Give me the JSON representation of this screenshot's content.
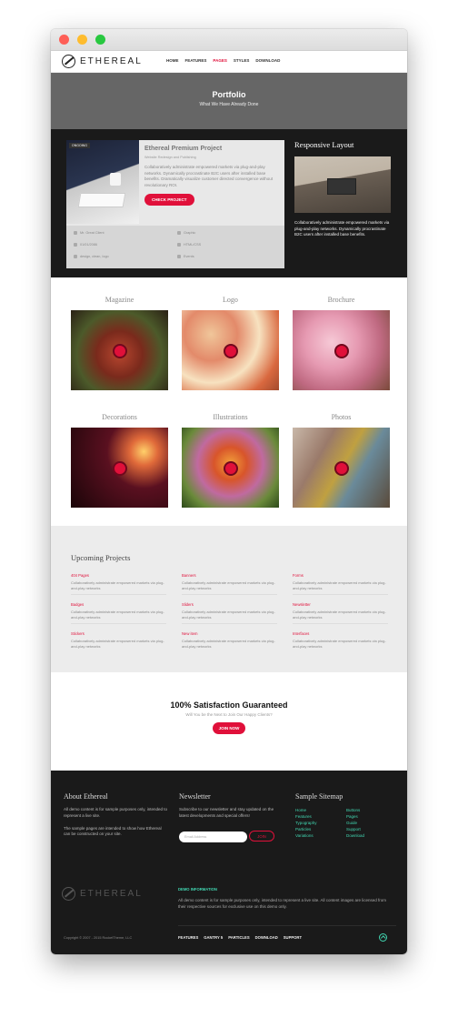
{
  "nav": {
    "logo_text": "ETHEREAL",
    "items": [
      "HOME",
      "FEATURES",
      "PAGES",
      "STYLES",
      "DOWNLOAD"
    ]
  },
  "hero": {
    "title": "Portfolio",
    "subtitle": "What We Have Already Done"
  },
  "featured": {
    "badge": "ONGOING",
    "title": "Ethereal Premium Project",
    "subtitle": "Website Redesign and Publishing",
    "description": "Collaboratively administrate empowered markets via plug-and-play networks. Dynamically procrastinate B2C users after installed base benefits. Dramatically visualize customer directed convergence without revolutionary ROI.",
    "button": "CHECK PROJECT",
    "meta": {
      "client": "Mr. Great Client",
      "date": "01/01/2086",
      "tags": "design, clean, logo",
      "type1": "Graphic",
      "type2": "HTML/CSS",
      "type3": "Events"
    }
  },
  "sidebar": {
    "title": "Responsive Layout",
    "text": "Collaboratively administrate empowered markets via plug-and-play networks. Dynamically procrastinate B2C users after installed base benefits."
  },
  "portfolio": [
    {
      "title": "Magazine"
    },
    {
      "title": "Logo"
    },
    {
      "title": "Brochure"
    },
    {
      "title": "Decorations"
    },
    {
      "title": "Illustrations"
    },
    {
      "title": "Photos"
    }
  ],
  "upcoming": {
    "title": "Upcoming Projects",
    "desc": "Collaboratively administrate empowered markets via plug-and-play networks",
    "items": [
      "404 Pages",
      "Banners",
      "Forms",
      "Badges",
      "Sliders",
      "Newsletter",
      "Stickers",
      "New item",
      "Interfaces"
    ]
  },
  "satisfaction": {
    "title": "100% Satisfaction Guaranteed",
    "subtitle": "Will You be the Next to Join Our Happy Clients?",
    "button": "JOIN NOW"
  },
  "footer": {
    "about_title": "About Ethereal",
    "about_p1": "All demo content is for sample purposes only, intended to represent a live site.",
    "about_p2": "The sample pages are intended to show how Ethereal can be constructed on your site.",
    "newsletter_title": "Newsletter",
    "newsletter_text": "Subscribe to our newsletter and stay updated on the latest developments and special offers!",
    "email_placeholder": "Email Address",
    "join": "JOIN",
    "sitemap_title": "Sample Sitemap",
    "sitemap_links": [
      "Home",
      "Buttons",
      "Features",
      "Pages",
      "Typography",
      "Guide",
      "Particles",
      "Support",
      "Variations",
      "Download"
    ],
    "logo_text": "ETHEREAL",
    "demo_heading": "DEMO INFORMATION",
    "demo_text": "All demo content is for sample purposes only, intended to represent a live site. All content images are licensed from their respective sources for exclusive use on this demo only.",
    "copyright": "Copyright © 2007 - 2015 RocketTheme, LLC",
    "links": [
      "FEATURES",
      "GANTRY 5",
      "PARTICLES",
      "DOWNLOAD",
      "SUPPORT"
    ]
  },
  "colors": {
    "accent": "#e0103a",
    "footer_link": "#41d6b1"
  }
}
